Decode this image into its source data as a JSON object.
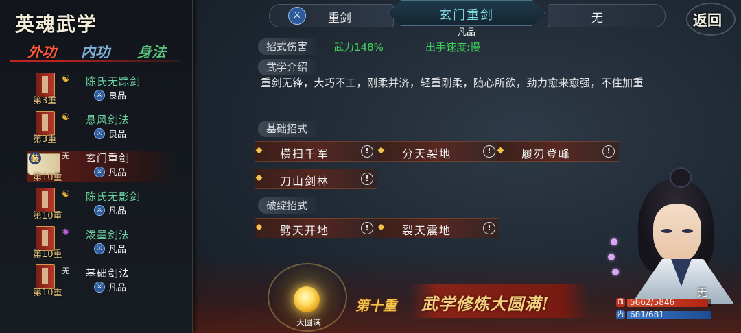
{
  "left_panel": {
    "title": "英魂武学",
    "tabs": [
      {
        "label": "外功",
        "active": true
      },
      {
        "label": "内功",
        "active": false
      },
      {
        "label": "身法",
        "active": false
      }
    ],
    "skills": [
      {
        "level": "第3重",
        "name": "陈氏无踪剑",
        "rank": "良品",
        "element_icon": "sun-icon",
        "name_color": "#6fd6a2",
        "selected": false
      },
      {
        "level": "第3重",
        "name": "悬风剑法",
        "rank": "良品",
        "element_icon": "sun-icon",
        "name_color": "#6fd6a2",
        "selected": false
      },
      {
        "level": "第10重",
        "name": "玄门重剑",
        "rank": "凡品",
        "element_icon": "none-icon",
        "element_text": "无",
        "name_color": "#f1f1f1",
        "selected": true,
        "equipped_tag": "装"
      },
      {
        "level": "第10重",
        "name": "陈氏无影剑",
        "rank": "凡品",
        "element_icon": "sun-icon",
        "name_color": "#6fd6a2",
        "selected": false
      },
      {
        "level": "第10重",
        "name": "泼墨剑法",
        "rank": "凡品",
        "element_icon": "vortex-icon",
        "name_color": "#6fd6a2",
        "selected": false
      },
      {
        "level": "第10重",
        "name": "基础剑法",
        "rank": "凡品",
        "element_icon": "none-icon",
        "element_text": "无",
        "name_color": "#f1f1f1",
        "selected": false
      }
    ]
  },
  "header": {
    "weapon_type": "重剑",
    "skill_title": "玄门重剑",
    "skill_rank": "凡品",
    "element": "无",
    "back_label": "返回"
  },
  "stats": {
    "label": "招式伤害",
    "power": "武力148%",
    "speed": "出手速度:慢"
  },
  "intro": {
    "label": "武学介绍",
    "text": "重剑无锋，大巧不工，刚柔并济，轻重刚柔，随心所欲，劲力愈来愈强，不住加重"
  },
  "basic_moves": {
    "label": "基础招式",
    "moves": [
      "横扫千军",
      "分天裂地",
      "履刃登峰",
      "刀山剑林"
    ]
  },
  "break_moves": {
    "label": "破绽招式",
    "moves": [
      "劈天开地",
      "裂天震地"
    ]
  },
  "mastery": {
    "orb_label": "大圆满",
    "tier": "第十重",
    "banner": "武学修炼大圆满!"
  },
  "character": {
    "element": "无",
    "hp_icon": "血",
    "mp_icon": "内",
    "hp": "5662/5846",
    "mp": "681/681",
    "hp_fraction": 0.968,
    "mp_fraction": 1.0
  },
  "colors": {
    "accent_red": "#ff5a3a",
    "stat_green": "#3fd25a",
    "title_cyan": "#7fdde0",
    "gold": "#f3c44a"
  }
}
